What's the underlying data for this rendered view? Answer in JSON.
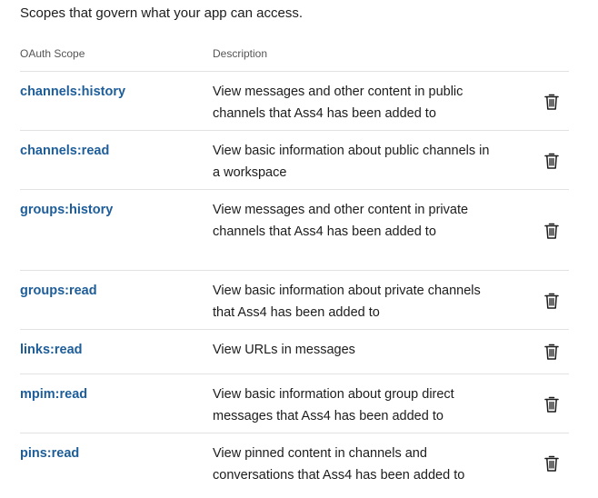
{
  "intro": "Scopes that govern what your app can access.",
  "table": {
    "header": {
      "scope": "OAuth Scope",
      "description": "Description"
    },
    "rows": [
      {
        "scope": "channels:history",
        "description": "View messages and other content in public channels that Ass4 has been added to",
        "icon": "trash-icon"
      },
      {
        "scope": "channels:read",
        "description": "View basic information about public channels in a workspace",
        "icon": "trash-icon"
      },
      {
        "scope": "groups:history",
        "description": "View messages and other content in private channels that Ass4 has been added to",
        "icon": "trash-icon"
      },
      {
        "scope": "groups:read",
        "description": "View basic information about private channels that Ass4 has been added to",
        "icon": "trash-icon"
      },
      {
        "scope": "links:read",
        "description": "View URLs in messages",
        "icon": "trash-icon"
      },
      {
        "scope": "mpim:read",
        "description": "View basic information about group direct messages that Ass4 has been added to",
        "icon": "trash-icon"
      },
      {
        "scope": "pins:read",
        "description": "View pinned content in channels and conversations that Ass4 has been added to",
        "icon": "trash-icon"
      }
    ]
  },
  "colors": {
    "scope_link": "#1d5d99",
    "text": "#1d1c1d",
    "header_text": "#555555",
    "divider": "#e2e2e2"
  }
}
